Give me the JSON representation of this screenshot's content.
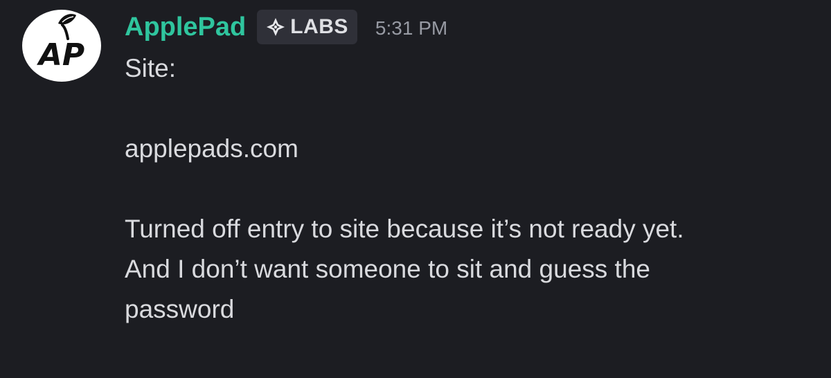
{
  "message": {
    "author": "ApplePad",
    "avatar_text": "AP",
    "tag": {
      "label": "LABS",
      "icon": "diamond-sparkle-icon"
    },
    "timestamp": "5:31 PM",
    "lines": [
      "Site:",
      "",
      "applepads.com",
      "",
      "Turned off entry to site because it’s not ready yet.",
      "And I don’t want someone to sit and guess the",
      "password"
    ]
  },
  "colors": {
    "background": "#1c1d22",
    "username": "#2fc59e",
    "tag_background": "#2f3038",
    "tag_text": "#dfe0e4",
    "timestamp": "#979aa3",
    "message_text": "#d9dade"
  }
}
